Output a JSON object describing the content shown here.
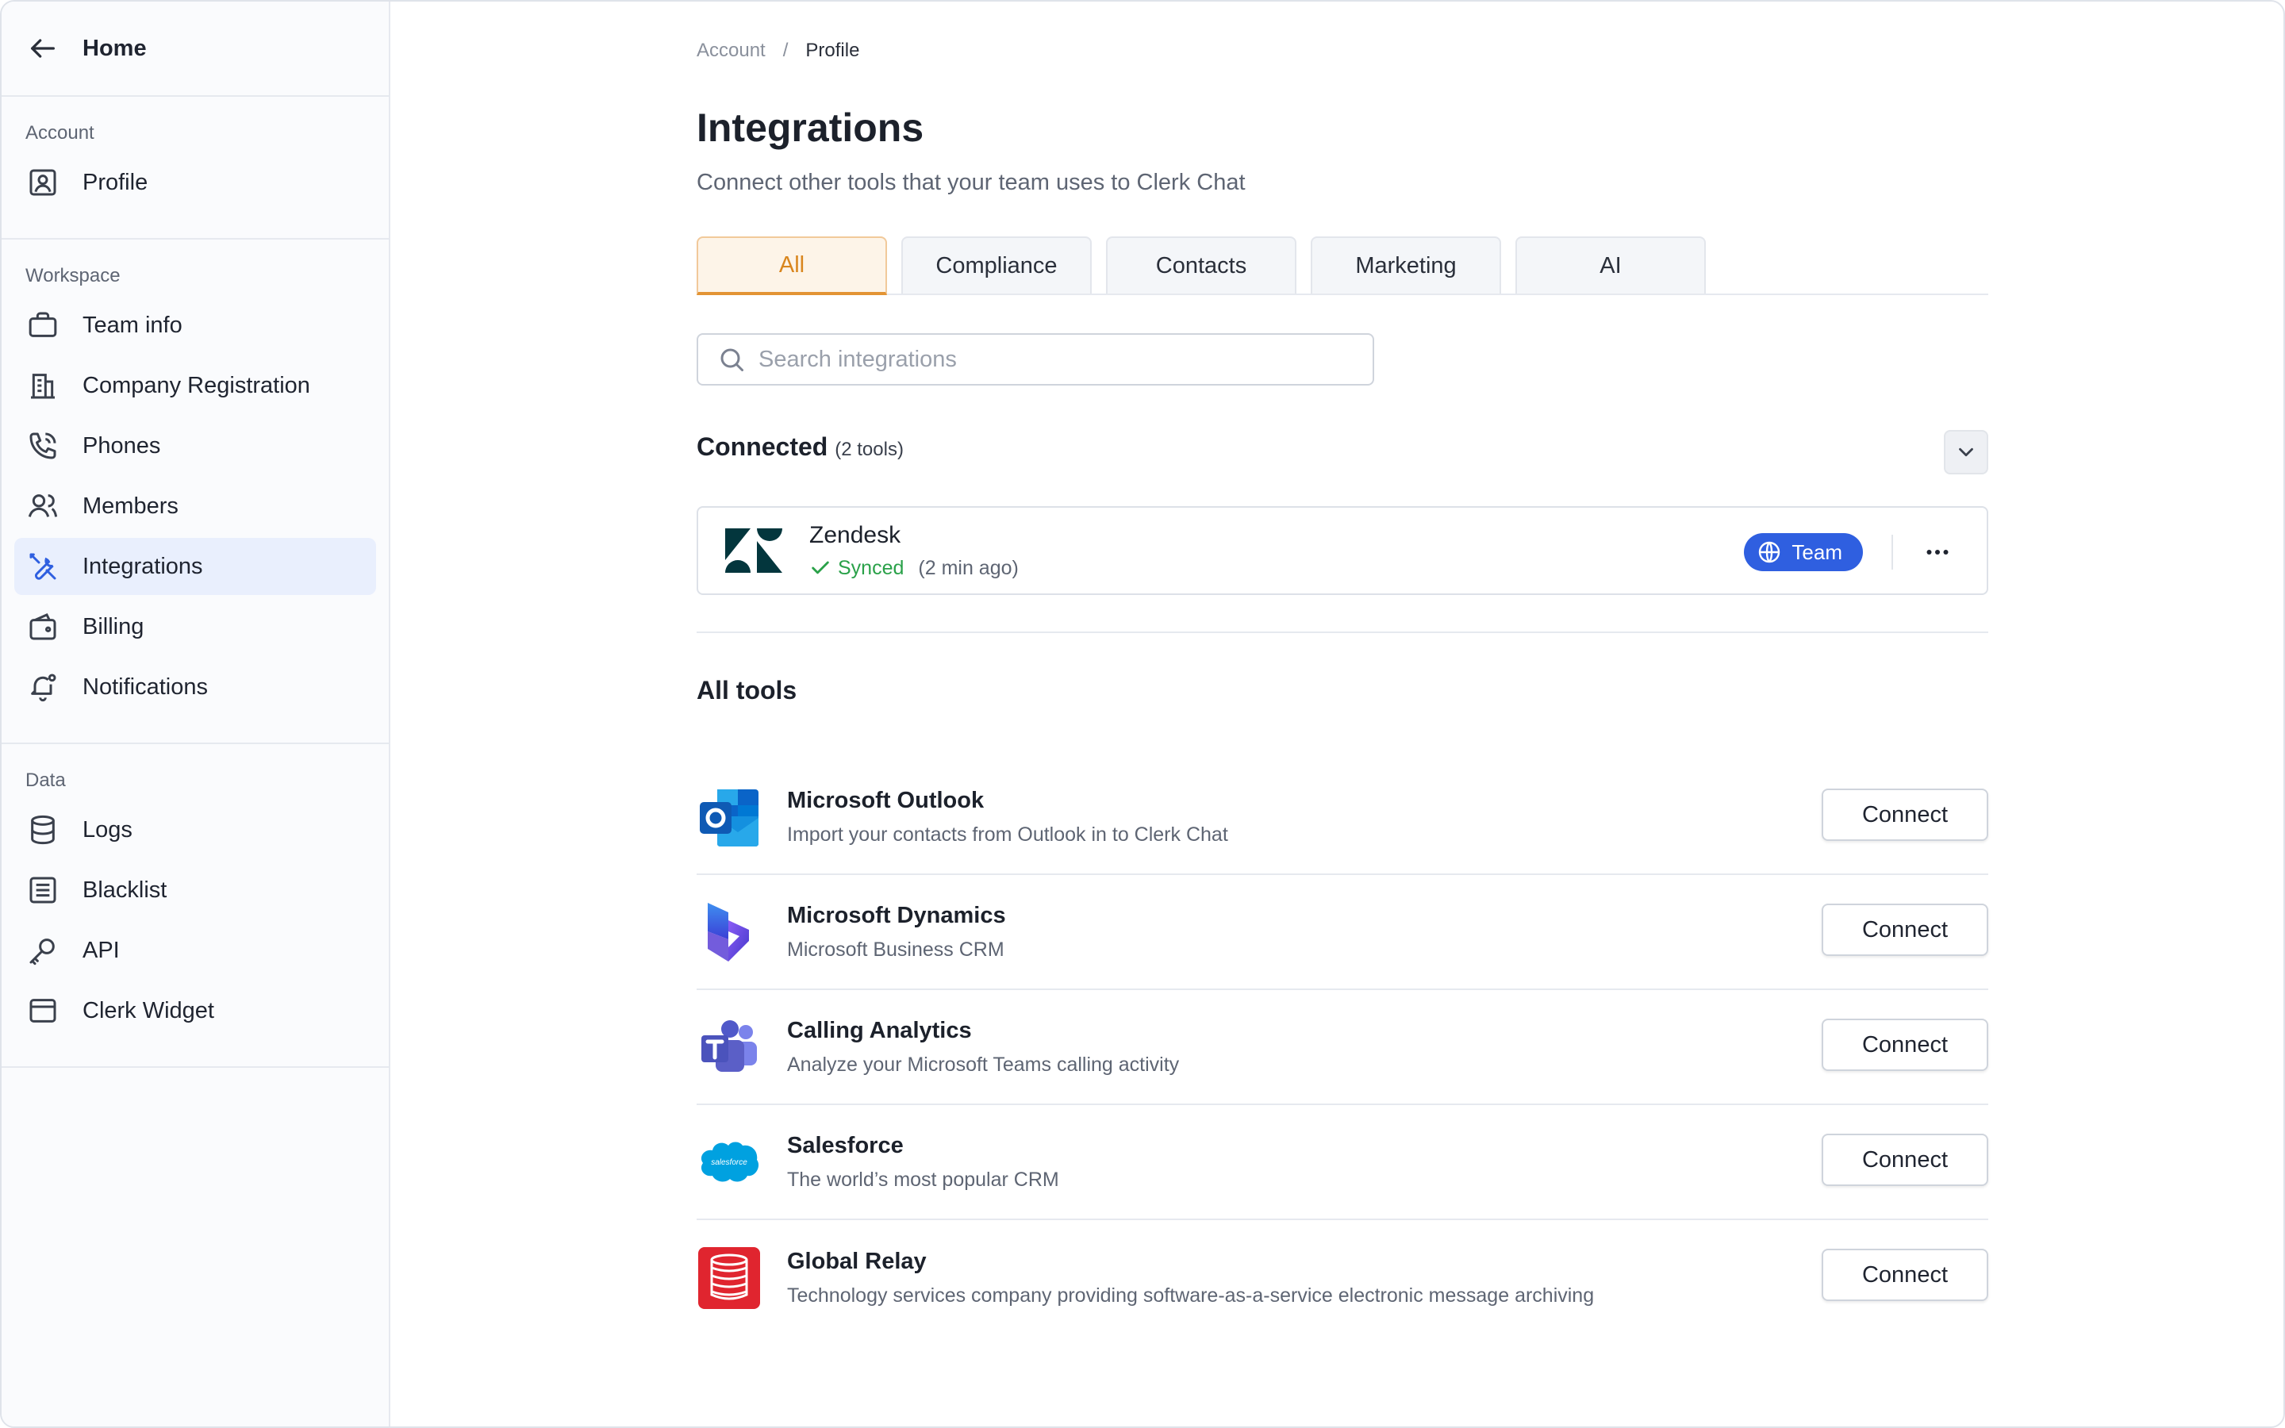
{
  "sidebar": {
    "home_label": "Home",
    "sections": [
      {
        "title": "Account",
        "items": [
          {
            "label": "Profile",
            "icon": "profile-icon"
          }
        ]
      },
      {
        "title": "Workspace",
        "items": [
          {
            "label": "Team info",
            "icon": "briefcase-icon"
          },
          {
            "label": "Company Registration",
            "icon": "building-icon"
          },
          {
            "label": "Phones",
            "icon": "phone-icon"
          },
          {
            "label": "Members",
            "icon": "users-icon"
          },
          {
            "label": "Integrations",
            "icon": "tools-icon",
            "active": true
          },
          {
            "label": "Billing",
            "icon": "wallet-icon"
          },
          {
            "label": "Notifications",
            "icon": "bell-icon"
          }
        ]
      },
      {
        "title": "Data",
        "items": [
          {
            "label": "Logs",
            "icon": "database-icon"
          },
          {
            "label": "Blacklist",
            "icon": "list-icon"
          },
          {
            "label": "API",
            "icon": "key-icon"
          },
          {
            "label": "Clerk Widget",
            "icon": "widget-icon"
          }
        ]
      }
    ]
  },
  "breadcrumb": {
    "parent": "Account",
    "separator": "/",
    "current": "Profile"
  },
  "page": {
    "title": "Integrations",
    "subtitle": "Connect other tools that your team uses to Clerk Chat"
  },
  "tabs": [
    {
      "label": "All",
      "active": true
    },
    {
      "label": "Compliance"
    },
    {
      "label": "Contacts"
    },
    {
      "label": "Marketing"
    },
    {
      "label": "AI"
    }
  ],
  "search": {
    "placeholder": "Search integrations",
    "value": ""
  },
  "connected": {
    "title": "Connected",
    "count": "(2 tools)",
    "item": {
      "name": "Zendesk",
      "status": "Synced",
      "ago": "(2 min ago)",
      "badge": "Team"
    }
  },
  "all_tools": {
    "title": "All tools",
    "connect_label": "Connect",
    "items": [
      {
        "name": "Microsoft Outlook",
        "desc": "Import your contacts from Outlook in to Clerk Chat",
        "logo": "outlook-logo"
      },
      {
        "name": "Microsoft Dynamics",
        "desc": "Microsoft Business CRM",
        "logo": "dynamics-logo"
      },
      {
        "name": "Calling Analytics",
        "desc": "Analyze your Microsoft Teams calling activity",
        "logo": "teams-logo"
      },
      {
        "name": "Salesforce",
        "desc": "The world’s most popular CRM",
        "logo": "salesforce-logo",
        "logo_text": "salesforce"
      },
      {
        "name": "Global Relay",
        "desc": "Technology services company providing software-as-a-service electronic message archiving",
        "logo": "global-relay-logo"
      }
    ]
  },
  "colors": {
    "accent_blue": "#2f5fe0",
    "tab_active": "#e39434",
    "synced_green": "#2aa149",
    "sidebar_active_bg": "#e9effd"
  }
}
